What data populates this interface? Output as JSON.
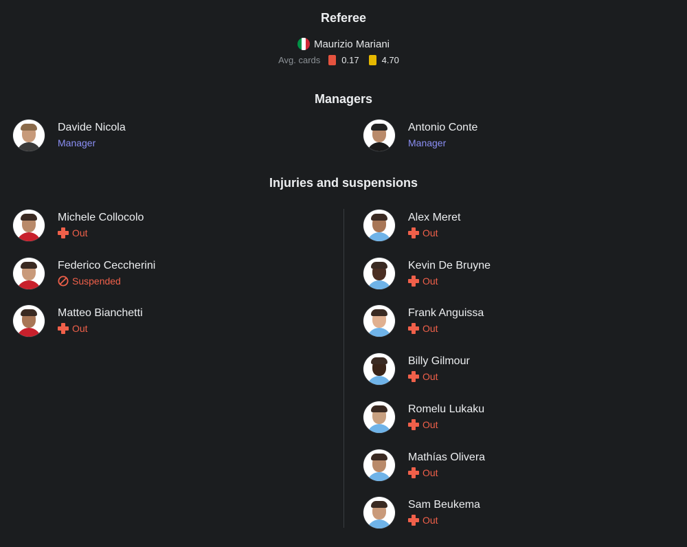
{
  "referee": {
    "heading": "Referee",
    "name": "Maurizio Mariani",
    "flag_colors": [
      "#009246",
      "#ffffff",
      "#ce2b37"
    ],
    "avg_cards_label": "Avg. cards",
    "red_avg": "0.17",
    "yellow_avg": "4.70",
    "red_color": "#e5533f",
    "yellow_color": "#e6b800"
  },
  "managers": {
    "heading": "Managers",
    "home": {
      "name": "Davide Nicola",
      "role": "Manager"
    },
    "away": {
      "name": "Antonio Conte",
      "role": "Manager"
    }
  },
  "injuries": {
    "heading": "Injuries and suspensions",
    "home": [
      {
        "name": "Michele Collocolo",
        "status": "Out",
        "icon": "plus-icon"
      },
      {
        "name": "Federico Ceccherini",
        "status": "Suspended",
        "icon": "ban-icon"
      },
      {
        "name": "Matteo Bianchetti",
        "status": "Out",
        "icon": "plus-icon"
      }
    ],
    "away": [
      {
        "name": "Alex Meret",
        "status": "Out",
        "icon": "plus-icon"
      },
      {
        "name": "Kevin De Bruyne",
        "status": "Out",
        "icon": "plus-icon"
      },
      {
        "name": "Frank Anguissa",
        "status": "Out",
        "icon": "plus-icon"
      },
      {
        "name": "Billy Gilmour",
        "status": "Out",
        "icon": "plus-icon"
      },
      {
        "name": "Romelu Lukaku",
        "status": "Out",
        "icon": "plus-icon"
      },
      {
        "name": "Mathías Olivera",
        "status": "Out",
        "icon": "plus-icon"
      },
      {
        "name": "Sam Beukema",
        "status": "Out",
        "icon": "plus-icon"
      }
    ]
  },
  "colors": {
    "status_red": "#f0604a",
    "manager_role": "#8b8ff5",
    "home_kit": "#c8202c",
    "away_kit": "#6fb3e8"
  }
}
